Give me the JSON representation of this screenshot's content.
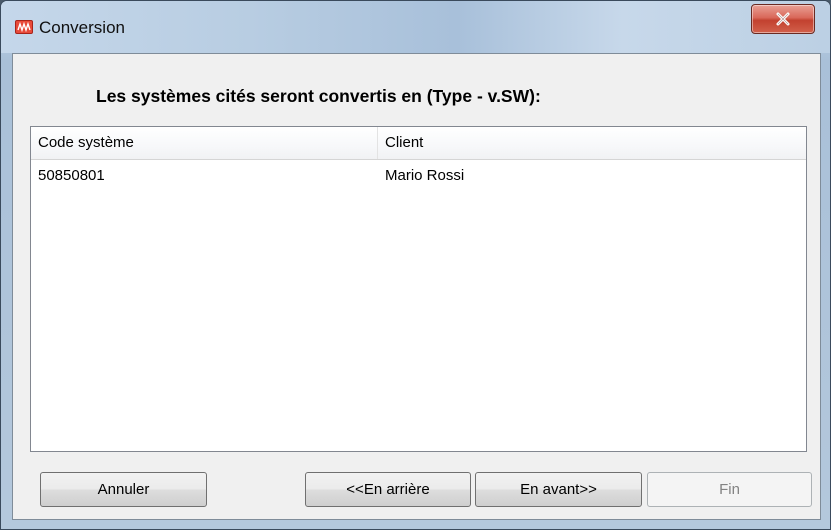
{
  "window": {
    "title": "Conversion",
    "icon": "app-logo-icon",
    "close_icon": "close-icon"
  },
  "header": {
    "text": "Les systèmes cités seront convertis en (Type - v.SW):"
  },
  "table": {
    "columns": [
      "Code système",
      "Client"
    ],
    "rows": [
      [
        "50850801",
        "Mario Rossi"
      ]
    ]
  },
  "buttons": {
    "cancel": "Annuler",
    "back": "<<En arrière",
    "next": "En avant>>",
    "finish": "Fin"
  }
}
